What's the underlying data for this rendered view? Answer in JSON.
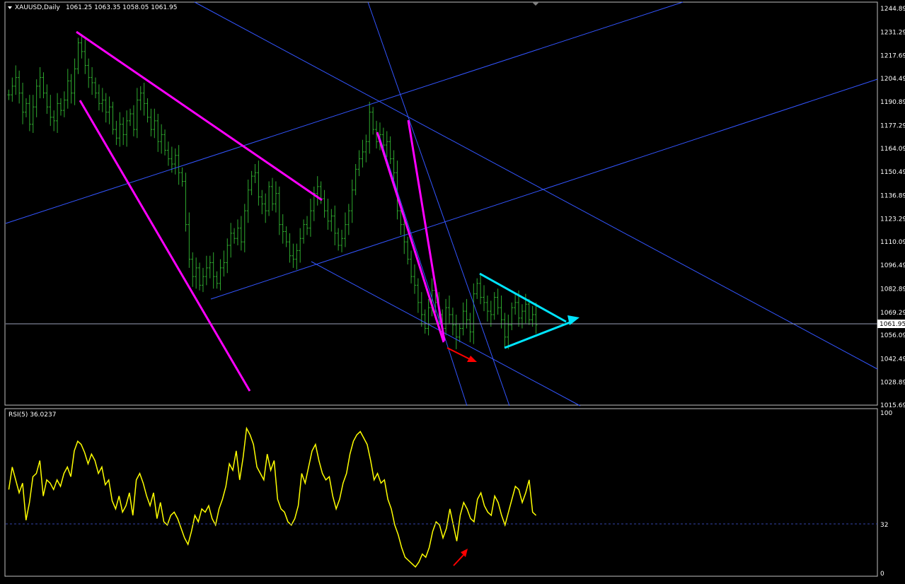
{
  "header": {
    "symbol": "XAUUSD,Daily",
    "ohlc": "1061.25 1063.35 1058.05 1061.95"
  },
  "rsi_header": {
    "label": "RSI(5) 36.0237"
  },
  "colors": {
    "background": "#000000",
    "bars": "#2ea82e",
    "rsi": "#ffff00",
    "trend_magenta": "#ff00ff",
    "triangle_cyan": "#00e5ff",
    "arrow_red": "#ff0000",
    "channel_blue": "#3355ff",
    "grid_frame": "#c0c0c0"
  },
  "chart_data": [
    {
      "type": "line",
      "subtype": "ohlc-bars",
      "title": "XAUUSD,Daily",
      "ylim": [
        1015.69,
        1244.89
      ],
      "current_price": "1061.95",
      "y_ticks": [
        "1244.89",
        "1231.29",
        "1217.69",
        "1204.49",
        "1190.89",
        "1177.29",
        "1164.09",
        "1150.49",
        "1136.89",
        "1123.29",
        "1110.09",
        "1096.49",
        "1082.89",
        "1069.29",
        "1056.09",
        "1042.49",
        "1028.89",
        "1015.69"
      ],
      "closes": [
        1195,
        1200,
        1205,
        1196,
        1185,
        1190,
        1178,
        1188,
        1200,
        1205,
        1196,
        1188,
        1182,
        1180,
        1190,
        1186,
        1192,
        1203,
        1196,
        1210,
        1225,
        1220,
        1212,
        1205,
        1202,
        1196,
        1190,
        1192,
        1185,
        1188,
        1175,
        1170,
        1178,
        1172,
        1180,
        1184,
        1175,
        1192,
        1196,
        1190,
        1182,
        1175,
        1180,
        1168,
        1172,
        1163,
        1158,
        1155,
        1160,
        1150,
        1145,
        1120,
        1100,
        1090,
        1095,
        1085,
        1090,
        1095,
        1098,
        1090,
        1086,
        1095,
        1098,
        1108,
        1115,
        1112,
        1118,
        1110,
        1128,
        1140,
        1148,
        1150,
        1136,
        1132,
        1128,
        1142,
        1132,
        1138,
        1120,
        1116,
        1110,
        1102,
        1100,
        1105,
        1112,
        1120,
        1118,
        1128,
        1138,
        1142,
        1135,
        1128,
        1122,
        1125,
        1115,
        1108,
        1112,
        1120,
        1128,
        1140,
        1152,
        1158,
        1162,
        1168,
        1185,
        1175,
        1168,
        1172,
        1166,
        1168,
        1158,
        1150,
        1128,
        1120,
        1110,
        1100,
        1090,
        1085,
        1075,
        1068,
        1060,
        1072,
        1082,
        1075,
        1068,
        1060,
        1072,
        1068,
        1062,
        1055,
        1060,
        1070,
        1065,
        1058,
        1080,
        1086,
        1078,
        1075,
        1070,
        1068,
        1078,
        1072,
        1065,
        1055,
        1062,
        1072,
        1075,
        1066,
        1070,
        1074,
        1065,
        1068,
        1062
      ],
      "annotations": [
        "magenta trend lines",
        "blue channel lines",
        "cyan converging triangle",
        "red arrow"
      ]
    },
    {
      "type": "line",
      "title": "RSI(5) 36.0237",
      "ylim": [
        0,
        100
      ],
      "y_ticks": [
        "100",
        "32",
        "0"
      ],
      "level": 32,
      "values": [
        52,
        66,
        58,
        50,
        56,
        33,
        44,
        60,
        62,
        70,
        48,
        58,
        56,
        52,
        58,
        54,
        62,
        66,
        60,
        76,
        82,
        80,
        75,
        68,
        74,
        70,
        62,
        66,
        55,
        58,
        45,
        40,
        48,
        38,
        42,
        50,
        36,
        58,
        62,
        56,
        48,
        42,
        50,
        34,
        44,
        32,
        30,
        36,
        38,
        34,
        28,
        22,
        18,
        26,
        36,
        32,
        40,
        38,
        42,
        34,
        30,
        40,
        46,
        54,
        68,
        64,
        76,
        58,
        72,
        90,
        86,
        80,
        66,
        62,
        58,
        74,
        64,
        70,
        46,
        40,
        38,
        32,
        30,
        34,
        42,
        62,
        56,
        66,
        76,
        80,
        70,
        62,
        58,
        60,
        48,
        40,
        46,
        56,
        62,
        74,
        82,
        86,
        88,
        84,
        80,
        70,
        58,
        62,
        56,
        58,
        46,
        40,
        30,
        24,
        16,
        10,
        8,
        6,
        4,
        7,
        12,
        10,
        16,
        26,
        32,
        30,
        22,
        28,
        40,
        30,
        20,
        36,
        44,
        40,
        34,
        32,
        46,
        50,
        42,
        38,
        36,
        48,
        44,
        36,
        30,
        38,
        46,
        54,
        52,
        44,
        50,
        58,
        38,
        36
      ]
    }
  ]
}
